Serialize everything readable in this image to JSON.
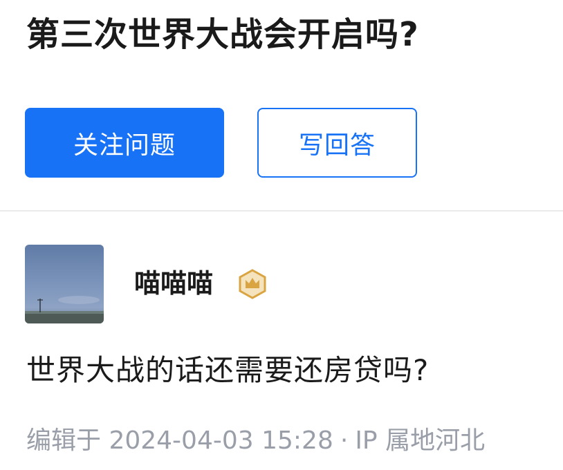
{
  "question": {
    "title": "第三次世界大战会开启吗?"
  },
  "actions": {
    "follow_label": "关注问题",
    "answer_label": "写回答",
    "accent_color": "#1772f6"
  },
  "answer": {
    "author": {
      "name": "喵喵喵",
      "avatar_icon": "avatar-sky-landscape",
      "badge_icon": "crown-hexagon-icon",
      "badge_color": "#d9a441"
    },
    "content": "世界大战的话还需要还房贷吗?",
    "meta": {
      "edited": "编辑于 2024-04-03 15:28",
      "separator": "·",
      "ip_location": "IP 属地河北"
    }
  }
}
